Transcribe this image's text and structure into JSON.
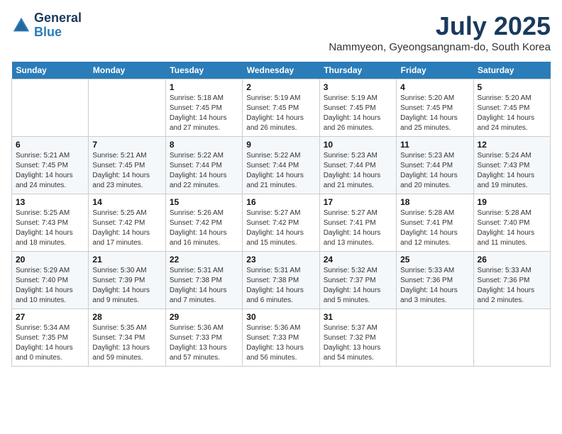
{
  "header": {
    "logo_general": "General",
    "logo_blue": "Blue",
    "month_title": "July 2025",
    "subtitle": "Nammyeon, Gyeongsangnam-do, South Korea"
  },
  "days_of_week": [
    "Sunday",
    "Monday",
    "Tuesday",
    "Wednesday",
    "Thursday",
    "Friday",
    "Saturday"
  ],
  "weeks": [
    [
      {
        "day": "",
        "sunrise": "",
        "sunset": "",
        "daylight": ""
      },
      {
        "day": "",
        "sunrise": "",
        "sunset": "",
        "daylight": ""
      },
      {
        "day": "1",
        "sunrise": "Sunrise: 5:18 AM",
        "sunset": "Sunset: 7:45 PM",
        "daylight": "Daylight: 14 hours and 27 minutes."
      },
      {
        "day": "2",
        "sunrise": "Sunrise: 5:19 AM",
        "sunset": "Sunset: 7:45 PM",
        "daylight": "Daylight: 14 hours and 26 minutes."
      },
      {
        "day": "3",
        "sunrise": "Sunrise: 5:19 AM",
        "sunset": "Sunset: 7:45 PM",
        "daylight": "Daylight: 14 hours and 26 minutes."
      },
      {
        "day": "4",
        "sunrise": "Sunrise: 5:20 AM",
        "sunset": "Sunset: 7:45 PM",
        "daylight": "Daylight: 14 hours and 25 minutes."
      },
      {
        "day": "5",
        "sunrise": "Sunrise: 5:20 AM",
        "sunset": "Sunset: 7:45 PM",
        "daylight": "Daylight: 14 hours and 24 minutes."
      }
    ],
    [
      {
        "day": "6",
        "sunrise": "Sunrise: 5:21 AM",
        "sunset": "Sunset: 7:45 PM",
        "daylight": "Daylight: 14 hours and 24 minutes."
      },
      {
        "day": "7",
        "sunrise": "Sunrise: 5:21 AM",
        "sunset": "Sunset: 7:45 PM",
        "daylight": "Daylight: 14 hours and 23 minutes."
      },
      {
        "day": "8",
        "sunrise": "Sunrise: 5:22 AM",
        "sunset": "Sunset: 7:44 PM",
        "daylight": "Daylight: 14 hours and 22 minutes."
      },
      {
        "day": "9",
        "sunrise": "Sunrise: 5:22 AM",
        "sunset": "Sunset: 7:44 PM",
        "daylight": "Daylight: 14 hours and 21 minutes."
      },
      {
        "day": "10",
        "sunrise": "Sunrise: 5:23 AM",
        "sunset": "Sunset: 7:44 PM",
        "daylight": "Daylight: 14 hours and 21 minutes."
      },
      {
        "day": "11",
        "sunrise": "Sunrise: 5:23 AM",
        "sunset": "Sunset: 7:44 PM",
        "daylight": "Daylight: 14 hours and 20 minutes."
      },
      {
        "day": "12",
        "sunrise": "Sunrise: 5:24 AM",
        "sunset": "Sunset: 7:43 PM",
        "daylight": "Daylight: 14 hours and 19 minutes."
      }
    ],
    [
      {
        "day": "13",
        "sunrise": "Sunrise: 5:25 AM",
        "sunset": "Sunset: 7:43 PM",
        "daylight": "Daylight: 14 hours and 18 minutes."
      },
      {
        "day": "14",
        "sunrise": "Sunrise: 5:25 AM",
        "sunset": "Sunset: 7:42 PM",
        "daylight": "Daylight: 14 hours and 17 minutes."
      },
      {
        "day": "15",
        "sunrise": "Sunrise: 5:26 AM",
        "sunset": "Sunset: 7:42 PM",
        "daylight": "Daylight: 14 hours and 16 minutes."
      },
      {
        "day": "16",
        "sunrise": "Sunrise: 5:27 AM",
        "sunset": "Sunset: 7:42 PM",
        "daylight": "Daylight: 14 hours and 15 minutes."
      },
      {
        "day": "17",
        "sunrise": "Sunrise: 5:27 AM",
        "sunset": "Sunset: 7:41 PM",
        "daylight": "Daylight: 14 hours and 13 minutes."
      },
      {
        "day": "18",
        "sunrise": "Sunrise: 5:28 AM",
        "sunset": "Sunset: 7:41 PM",
        "daylight": "Daylight: 14 hours and 12 minutes."
      },
      {
        "day": "19",
        "sunrise": "Sunrise: 5:28 AM",
        "sunset": "Sunset: 7:40 PM",
        "daylight": "Daylight: 14 hours and 11 minutes."
      }
    ],
    [
      {
        "day": "20",
        "sunrise": "Sunrise: 5:29 AM",
        "sunset": "Sunset: 7:40 PM",
        "daylight": "Daylight: 14 hours and 10 minutes."
      },
      {
        "day": "21",
        "sunrise": "Sunrise: 5:30 AM",
        "sunset": "Sunset: 7:39 PM",
        "daylight": "Daylight: 14 hours and 9 minutes."
      },
      {
        "day": "22",
        "sunrise": "Sunrise: 5:31 AM",
        "sunset": "Sunset: 7:38 PM",
        "daylight": "Daylight: 14 hours and 7 minutes."
      },
      {
        "day": "23",
        "sunrise": "Sunrise: 5:31 AM",
        "sunset": "Sunset: 7:38 PM",
        "daylight": "Daylight: 14 hours and 6 minutes."
      },
      {
        "day": "24",
        "sunrise": "Sunrise: 5:32 AM",
        "sunset": "Sunset: 7:37 PM",
        "daylight": "Daylight: 14 hours and 5 minutes."
      },
      {
        "day": "25",
        "sunrise": "Sunrise: 5:33 AM",
        "sunset": "Sunset: 7:36 PM",
        "daylight": "Daylight: 14 hours and 3 minutes."
      },
      {
        "day": "26",
        "sunrise": "Sunrise: 5:33 AM",
        "sunset": "Sunset: 7:36 PM",
        "daylight": "Daylight: 14 hours and 2 minutes."
      }
    ],
    [
      {
        "day": "27",
        "sunrise": "Sunrise: 5:34 AM",
        "sunset": "Sunset: 7:35 PM",
        "daylight": "Daylight: 14 hours and 0 minutes."
      },
      {
        "day": "28",
        "sunrise": "Sunrise: 5:35 AM",
        "sunset": "Sunset: 7:34 PM",
        "daylight": "Daylight: 13 hours and 59 minutes."
      },
      {
        "day": "29",
        "sunrise": "Sunrise: 5:36 AM",
        "sunset": "Sunset: 7:33 PM",
        "daylight": "Daylight: 13 hours and 57 minutes."
      },
      {
        "day": "30",
        "sunrise": "Sunrise: 5:36 AM",
        "sunset": "Sunset: 7:33 PM",
        "daylight": "Daylight: 13 hours and 56 minutes."
      },
      {
        "day": "31",
        "sunrise": "Sunrise: 5:37 AM",
        "sunset": "Sunset: 7:32 PM",
        "daylight": "Daylight: 13 hours and 54 minutes."
      },
      {
        "day": "",
        "sunrise": "",
        "sunset": "",
        "daylight": ""
      },
      {
        "day": "",
        "sunrise": "",
        "sunset": "",
        "daylight": ""
      }
    ]
  ]
}
